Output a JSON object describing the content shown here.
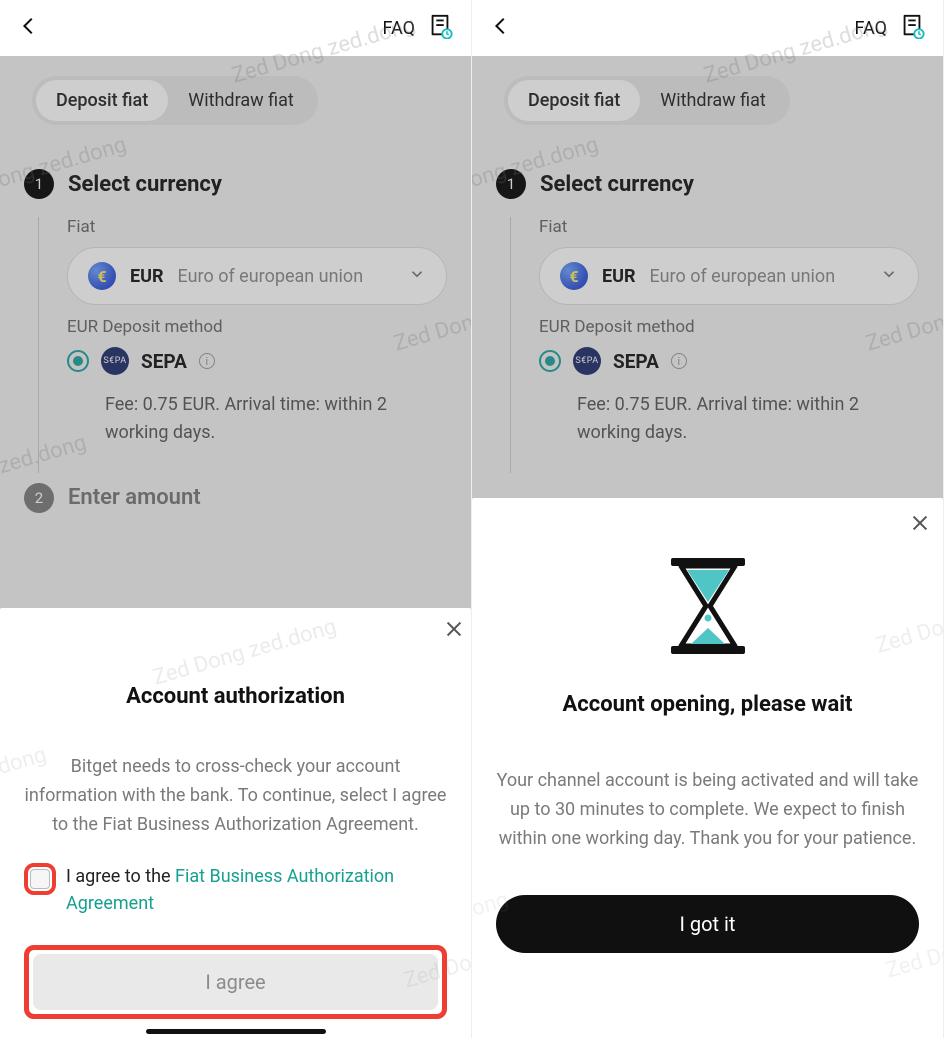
{
  "watermark": "Zed Dong zed.dong",
  "left": {
    "top": {
      "faq": "FAQ"
    },
    "tabs": {
      "deposit": "Deposit fiat",
      "withdraw": "Withdraw fiat",
      "active": "deposit"
    },
    "step1": {
      "num": "1",
      "title": "Select currency",
      "fiat_label": "Fiat",
      "currency": {
        "code": "EUR",
        "name": "Euro of european union",
        "symbol": "€"
      },
      "method_label": "EUR Deposit method",
      "method": {
        "name": "SEPA",
        "badge": "S€PA"
      },
      "fee_text": "Fee: 0.75 EUR. Arrival time: within 2 working days."
    },
    "step2": {
      "num": "2",
      "title": "Enter amount"
    },
    "sheet": {
      "title": "Account authorization",
      "body": "Bitget needs to cross-check your account information with the bank. To continue, select I agree to the Fiat Business Authorization Agreement.",
      "agree_prefix": "I agree to the ",
      "agree_link": "Fiat Business Authorization Agreement",
      "button": "I agree"
    }
  },
  "right": {
    "top": {
      "faq": "FAQ"
    },
    "tabs": {
      "deposit": "Deposit fiat",
      "withdraw": "Withdraw fiat",
      "active": "deposit"
    },
    "step1": {
      "num": "1",
      "title": "Select currency",
      "fiat_label": "Fiat",
      "currency": {
        "code": "EUR",
        "name": "Euro of european union",
        "symbol": "€"
      },
      "method_label": "EUR Deposit method",
      "method": {
        "name": "SEPA",
        "badge": "S€PA"
      },
      "fee_text": "Fee: 0.75 EUR. Arrival time: within 2 working days."
    },
    "sheet": {
      "title": "Account opening, please wait",
      "body": "Your channel account is being activated and will take up to 30 minutes to complete. We expect to finish within one working day. Thank you for your patience.",
      "button": "I got it"
    }
  }
}
